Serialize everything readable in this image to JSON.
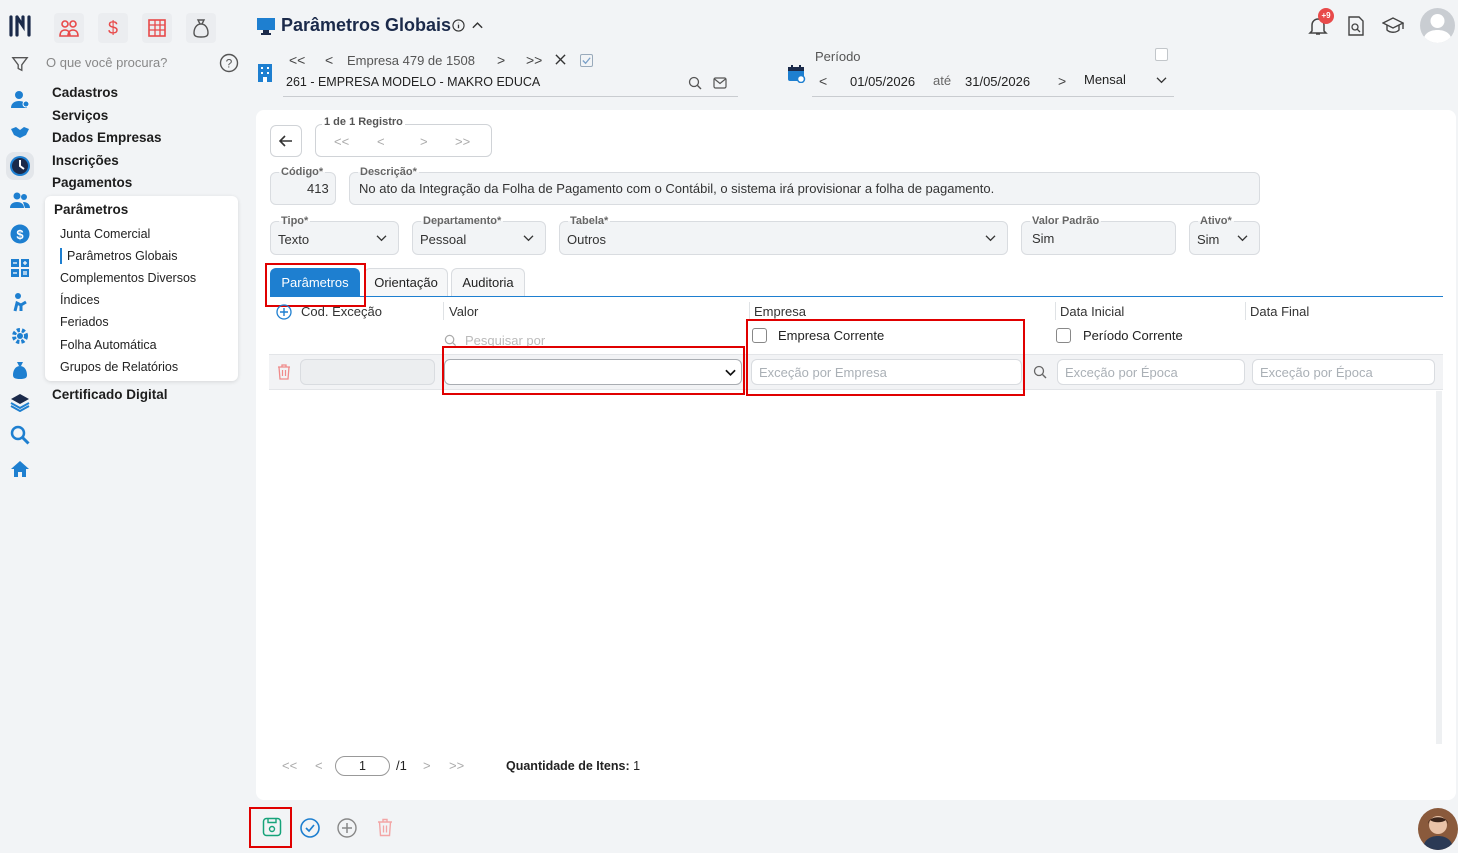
{
  "colors": {
    "accent": "#1e7fd0",
    "highlight": "#e00000",
    "sidebar_selected": "#1e7fd0"
  },
  "header": {
    "title": "Parâmetros Globais",
    "notification_count": "+9"
  },
  "search": {
    "placeholder": "O que você procura?"
  },
  "empresa": {
    "label": "Empresa 479 de 1508",
    "name": "261 - EMPRESA MODELO - MAKRO EDUCA"
  },
  "periodo": {
    "label": "Período",
    "start": "01/05/2026",
    "sep": "até",
    "end": "31/05/2026",
    "mode": "Mensal"
  },
  "sidebar": {
    "top_items": [
      "Cadastros",
      "Serviços",
      "Dados Empresas",
      "Inscrições",
      "Pagamentos"
    ],
    "section": "Parâmetros",
    "sub_items": [
      "Junta Comercial",
      "Parâmetros Globais",
      "Complementos Diversos",
      "Índices",
      "Feriados",
      "Folha Automática",
      "Grupos de Relatórios"
    ],
    "bottom_item": "Certificado Digital",
    "icons": [
      "logo-icon",
      "filter-icon",
      "user-icon",
      "handshake-icon",
      "clock-icon",
      "users-icon",
      "dollar-icon",
      "calculator-icon",
      "person-icon",
      "gear-icon",
      "money-bag-icon",
      "layers-icon",
      "search-icon",
      "home-icon"
    ]
  },
  "registro": {
    "label": "1 de 1 Registro"
  },
  "form": {
    "codigo": {
      "label": "Código*",
      "value": "413"
    },
    "descricao": {
      "label": "Descrição*",
      "value": "No ato da Integração da Folha de Pagamento com o Contábil, o sistema irá provisionar a folha de pagamento."
    },
    "tipo": {
      "label": "Tipo*",
      "value": "Texto"
    },
    "departamento": {
      "label": "Departamento*",
      "value": "Pessoal"
    },
    "tabela": {
      "label": "Tabela*",
      "value": "Outros"
    },
    "valor_padrao": {
      "label": "Valor Padrão",
      "value": "Sim"
    },
    "ativo": {
      "label": "Ativo*",
      "value": "Sim"
    }
  },
  "tabs": [
    {
      "label": "Parâmetros"
    },
    {
      "label": "Orientação"
    },
    {
      "label": "Auditoria"
    }
  ],
  "grid": {
    "columns": [
      "Cod. Exceção",
      "Valor",
      "Empresa",
      "Data Inicial",
      "Data Final"
    ],
    "search_placeholder": "Pesquisar por",
    "empresa_corrente": "Empresa Corrente",
    "periodo_corrente": "Período Corrente",
    "placeholder_empresa": "Exceção por Empresa",
    "placeholder_epoca": "Exceção por Época"
  },
  "pagination": {
    "page": "1",
    "total": "/1",
    "quantidade_label": "Quantidade de Itens:",
    "quantidade": "1"
  }
}
